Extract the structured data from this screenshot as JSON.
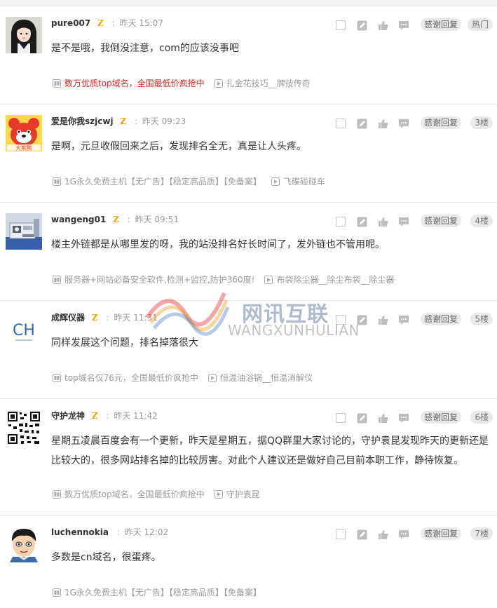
{
  "labels": {
    "thanks": "感谢回复",
    "zbadge": "Z",
    "separator": ":"
  },
  "colors": {
    "badge": "#f0a400",
    "ad_highlight": "#e02020",
    "pill_bg": "#e9e9e9"
  },
  "watermark": {
    "cn": "网讯互联",
    "en": "WANGXUNHULIAN"
  },
  "posts": [
    {
      "username": "pure007",
      "has_badge": true,
      "time": "昨天 15:07",
      "floor": "热门",
      "content": "是不是哦，我倒没注意，com的应该没事吧",
      "ad1": "数万优质top域名，全国最低价疯抢中",
      "ad1_red": true,
      "ad2": "扎金花技巧__牌技传奇",
      "avatar": "girl-photo"
    },
    {
      "username": "爱是你我szjcwj",
      "has_badge": true,
      "time": "昨天 09:23",
      "floor": "3楼",
      "content": "是啊，元旦收假回来之后，发现排名全无，真是让人头疼。",
      "ad1": "1G永久免费主机【无广告】【稳定高品质】【免备案】",
      "ad1_red": false,
      "ad2": "飞碟碰碰车",
      "avatar": "cartoon-bear"
    },
    {
      "username": "wangeng01",
      "has_badge": true,
      "time": "昨天 09:51",
      "floor": "4楼",
      "content": "楼主外链都是从哪里发的呀，我的站没排名好长时间了，发外链也不管用呢。",
      "ad1": "服务器+网站必备安全软件,检测+监控,防护360度!",
      "ad1_red": false,
      "ad2": "布袋除尘器__除尘布袋__除尘器",
      "avatar": "machine-photo"
    },
    {
      "username": "成辉仪器",
      "has_badge": true,
      "time": "昨天 11:31",
      "floor": "5楼",
      "content": "同样发展这个问题，排名掉落很大",
      "ad1": "top域名仅76元，全国最低价疯抢中",
      "ad1_red": false,
      "ad2": "恒温油浴锅__恒温消解仪",
      "avatar": "ch-logo",
      "avatar_text": "CH"
    },
    {
      "username": "守护龙神",
      "has_badge": true,
      "time": "昨天 11:42",
      "floor": "6楼",
      "content": "星期五凌晨百度会有一个更新，昨天是星期五，据QQ群里大家讨论的，守护袁昆发现昨天的更新还是比较大的，很多网站排名掉的比较厉害。对此个人建议还是做好自己目前本职工作，静待恢复。",
      "ad1": "数万优质top域名，全国最低价疯抢中",
      "ad1_red": false,
      "ad2": "守护袁昆",
      "avatar": "qr-code"
    },
    {
      "username": "luchennokia",
      "has_badge": false,
      "time": "昨天 12:02",
      "floor": "7楼",
      "content": "多数是cn域名，很蛋疼。",
      "ad1": "1G永久免费主机【无广告】【稳定高品质】【免备案】",
      "ad1_red": false,
      "ad2": "",
      "avatar": "cartoon-boy"
    }
  ]
}
